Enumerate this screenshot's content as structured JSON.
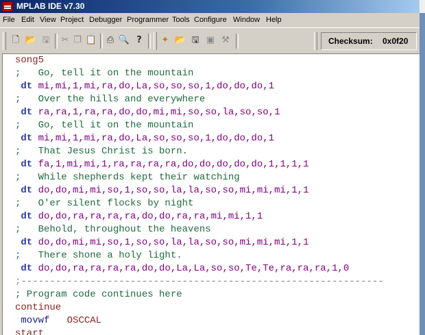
{
  "app": {
    "title": "MPLAB IDE v7.30"
  },
  "menu": [
    "File",
    "Edit",
    "View",
    "Project",
    "Debugger",
    "Programmer",
    "Tools",
    "Configure",
    "Window",
    "Help"
  ],
  "toolbar": {
    "icons": [
      "new-file-icon",
      "open-folder-icon",
      "save-icon",
      "cut-icon",
      "copy-icon",
      "paste-icon",
      "print-icon",
      "find-icon",
      "help-icon",
      "new-project-icon",
      "open-project-icon",
      "save-project-icon",
      "workspace-icon",
      "build-icon"
    ],
    "checksum_label": "Checksum:",
    "checksum_value": "0x0f20"
  },
  "code": [
    {
      "type": "label",
      "text": "song5"
    },
    {
      "type": "comment",
      "text": ";   Go, tell it on the mountain"
    },
    {
      "type": "dt",
      "text": "mi,mi,1,mi,ra,do,La,so,so,so,1,do,do,do,1"
    },
    {
      "type": "comment",
      "text": ";   Over the hills and everywhere"
    },
    {
      "type": "dt",
      "text": "ra,ra,1,ra,ra,do,do,mi,mi,so,so,la,so,so,1"
    },
    {
      "type": "comment",
      "text": ";   Go, tell it on the mountain"
    },
    {
      "type": "dt",
      "text": "mi,mi,1,mi,ra,do,La,so,so,so,1,do,do,do,1"
    },
    {
      "type": "comment",
      "text": ";   That Jesus Christ is born."
    },
    {
      "type": "dt",
      "text": "fa,1,mi,mi,1,ra,ra,ra,ra,do,do,do,do,do,1,1,1,1"
    },
    {
      "type": "comment",
      "text": ";   While shepherds kept their watching"
    },
    {
      "type": "dt",
      "text": "do,do,mi,mi,so,1,so,so,la,la,so,so,mi,mi,mi,1,1"
    },
    {
      "type": "comment",
      "text": ";   O'er silent flocks by night"
    },
    {
      "type": "dt",
      "text": "do,do,ra,ra,ra,ra,do,do,ra,ra,mi,mi,1,1"
    },
    {
      "type": "comment",
      "text": ";   Behold, throughout the heavens"
    },
    {
      "type": "dt",
      "text": "do,do,mi,mi,so,1,so,so,la,la,so,so,mi,mi,mi,1,1"
    },
    {
      "type": "comment",
      "text": ";   There shone a holy light."
    },
    {
      "type": "dt",
      "text": "do,do,ra,ra,ra,ra,do,do,La,La,so,so,Te,Te,ra,ra,ra,1,0"
    },
    {
      "type": "rule",
      "text": ";---------------------------------------------------------------"
    },
    {
      "type": "comment",
      "text": "; Program code continues here"
    },
    {
      "type": "label",
      "text": "continue"
    },
    {
      "type": "instr",
      "op": "movwf",
      "arg": "OSCCAL"
    },
    {
      "type": "label",
      "text": "start"
    }
  ],
  "colors": {
    "label": "#8b1f1f",
    "comment": "#1f6b3e",
    "directive": "#2b3aa3",
    "data": "#800080"
  }
}
